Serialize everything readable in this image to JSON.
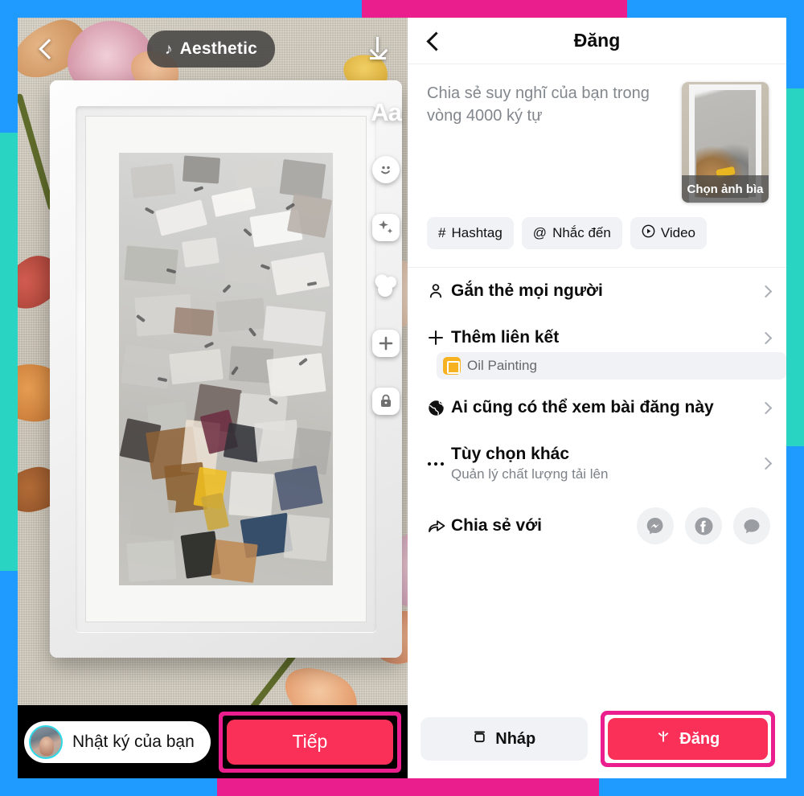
{
  "theme": {
    "frame_blue": "#1f9bff",
    "frame_magenta": "#ea1e8c",
    "frame_teal": "#2ad4c3",
    "accent_red": "#fb3058",
    "chip_grey": "#f0f2f5",
    "text_dark": "#0b0b0b",
    "text_muted": "#7d8288"
  },
  "left_editor": {
    "back_icon": "chevron-left-icon",
    "music_pill": {
      "icon": "music-note-icon",
      "label": "Aesthetic"
    },
    "download_icon": "download-icon",
    "tools": [
      {
        "name": "text-tool",
        "icon": "aa-text-icon",
        "label": "Aa"
      },
      {
        "name": "sticker-tool",
        "icon": "sticker-face-icon",
        "label": ""
      },
      {
        "name": "effects-tool",
        "icon": "sparkle-icon",
        "label": ""
      },
      {
        "name": "filter-tool",
        "icon": "color-circles-icon",
        "label": ""
      },
      {
        "name": "add-tool",
        "icon": "plus-icon",
        "label": ""
      },
      {
        "name": "privacy-tool",
        "icon": "lock-icon",
        "label": ""
      }
    ],
    "bottom": {
      "avatar": "user-avatar",
      "diary_label": "Nhật ký của bạn",
      "next_label": "Tiếp"
    }
  },
  "right_composer": {
    "header": {
      "back_icon": "chevron-left-icon",
      "title": "Đăng"
    },
    "compose": {
      "placeholder": "Chia sẻ suy nghĩ của bạn trong vòng 4000 ký tự",
      "cover": {
        "caption": "Chọn ảnh bìa"
      }
    },
    "chips": [
      {
        "name": "hashtag-chip",
        "icon": "hash-icon",
        "glyph": "#",
        "label": "Hashtag"
      },
      {
        "name": "mention-chip",
        "icon": "at-icon",
        "glyph": "@",
        "label": "Nhắc đến"
      },
      {
        "name": "video-chip",
        "icon": "play-circle-icon",
        "glyph": "▶",
        "label": "Video"
      }
    ],
    "rows": [
      {
        "name": "tag-people-row",
        "icon": "person-icon",
        "label": "Gắn thẻ mọi người",
        "sub": ""
      },
      {
        "name": "add-link-row",
        "icon": "plus-icon",
        "label": "Thêm liên kết",
        "sub": ""
      },
      {
        "name": "audience-row",
        "icon": "globe-icon",
        "label": "Ai cũng có thể xem bài đăng này",
        "sub": ""
      },
      {
        "name": "more-options-row",
        "icon": "ellipsis-icon",
        "label": "Tùy chọn khác",
        "sub": "Quản lý chất lượng tải lên"
      }
    ],
    "link_tag": {
      "icon": "oil-painting-app-icon",
      "label": "Oil Painting"
    },
    "share": {
      "icon": "share-arrow-icon",
      "label": "Chia sẻ với",
      "targets": [
        {
          "name": "share-messenger",
          "icon": "messenger-icon"
        },
        {
          "name": "share-facebook",
          "icon": "facebook-icon"
        },
        {
          "name": "share-sms",
          "icon": "chat-bubble-icon"
        }
      ]
    },
    "bottom": {
      "draft": {
        "icon": "archive-box-icon",
        "label": "Nháp"
      },
      "post": {
        "icon": "sparkle-star-icon",
        "label": "Đăng"
      }
    }
  }
}
